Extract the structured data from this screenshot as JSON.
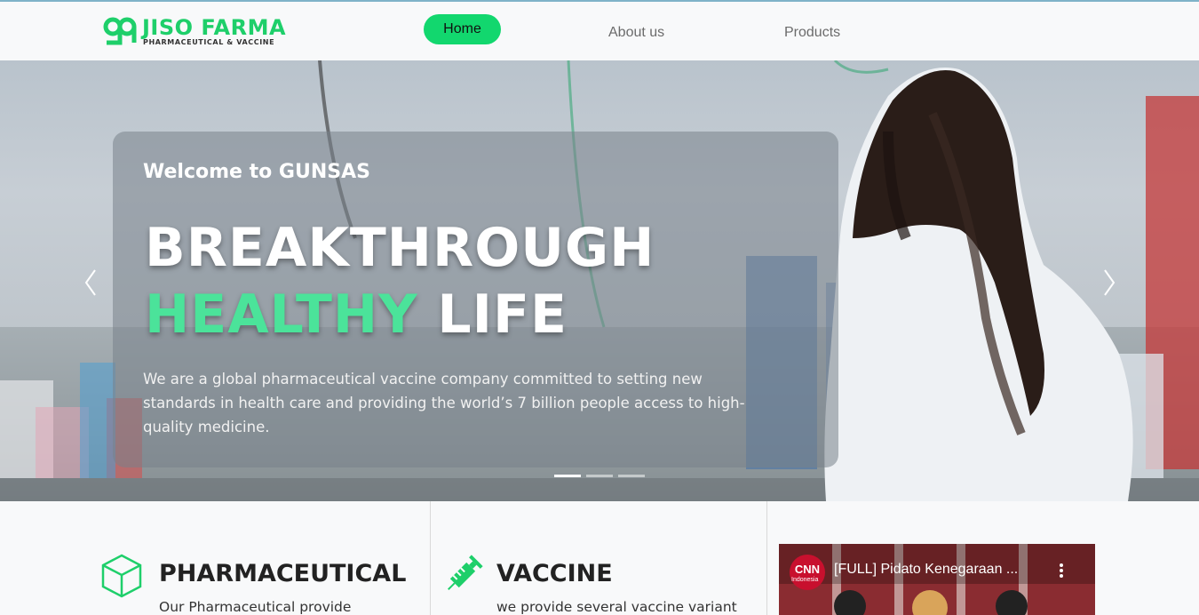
{
  "brand": {
    "name": "JISO FARMA",
    "tagline": "PHARMACEUTICAL & VACCINE",
    "accent": "#12d76e"
  },
  "nav": {
    "items": [
      {
        "label": "Home",
        "active": true
      },
      {
        "label": "About us",
        "active": false
      },
      {
        "label": "Products",
        "active": false
      }
    ]
  },
  "hero": {
    "welcome": "Welcome to GUNSAS",
    "headline_line1": "BREAKTHROUGH",
    "headline_green": "HEALTHY",
    "headline_white": "LIFE",
    "description": "We are a global pharmaceutical vaccine company committed to setting new standards in  health care and providing the world’s 7 billion people access to high-quality medicine.",
    "prev_icon": "chevron-left-icon",
    "next_icon": "chevron-right-icon",
    "slides": 3,
    "active_slide": 1
  },
  "services": [
    {
      "icon": "cube-icon",
      "title": "PHARMACEUTICAL",
      "text": "Our Pharmaceutical provide"
    },
    {
      "icon": "syringe-icon",
      "title": "VACCINE",
      "text": "we provide several vaccine variant"
    }
  ],
  "video": {
    "channel_logo": "CNN",
    "channel_sub": "Indonesia",
    "title": "[FULL] Pidato Kenegaraan ...",
    "menu_icon": "more-vert-icon"
  }
}
